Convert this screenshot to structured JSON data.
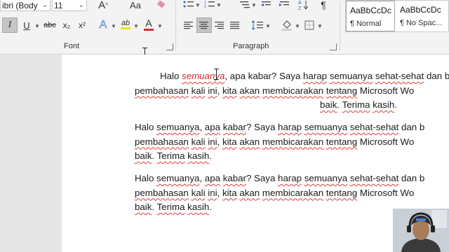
{
  "font": {
    "name_value": "ibri (Body",
    "size_value": "11",
    "group_label": "Font",
    "bold_italic_label": "I",
    "underline_label": "U",
    "strike_label": "abc",
    "subscript_label": "x₂",
    "superscript_label": "x²",
    "text_effects_label": "A",
    "change_case_label": "Aa",
    "highlight_label": "ab",
    "font_color_label": "A",
    "grow_label": "A",
    "highlight_color": "#f2e200",
    "font_color": "#d42a2a"
  },
  "paragraph": {
    "group_label": "Paragraph"
  },
  "styles": [
    {
      "preview": "AaBbCcDc",
      "name": "¶ Normal"
    },
    {
      "preview": "AaBbCcDc",
      "name": "¶ No Spac..."
    }
  ],
  "document": {
    "paragraphs": [
      {
        "align": "center",
        "lines": [
          [
            {
              "t": "Halo "
            },
            {
              "t": "semuanya",
              "s": "red"
            },
            {
              "t": ", apa kabar? Saya "
            },
            {
              "t": "harap",
              "s": "sq"
            },
            {
              "t": " "
            },
            {
              "t": "semuanya",
              "s": "sq"
            },
            {
              "t": " "
            },
            {
              "t": "sehat-sehat",
              "s": "sq"
            },
            {
              "t": " dan b"
            }
          ],
          [
            {
              "t": "pembahasan",
              "s": "sq"
            },
            {
              "t": " "
            },
            {
              "t": "kali",
              "s": "sq"
            },
            {
              "t": " "
            },
            {
              "t": "ini",
              "s": "sq"
            },
            {
              "t": ", "
            },
            {
              "t": "kita",
              "s": "sq"
            },
            {
              "t": " "
            },
            {
              "t": "akan",
              "s": "sq"
            },
            {
              "t": " "
            },
            {
              "t": "membicarakan",
              "s": "sq"
            },
            {
              "t": " "
            },
            {
              "t": "tentang",
              "s": "sq"
            },
            {
              "t": " Microsoft Wo"
            }
          ],
          [
            {
              "t": "baik",
              "s": "sq"
            },
            {
              "t": ". "
            },
            {
              "t": "Terima",
              "s": "sq"
            },
            {
              "t": " "
            },
            {
              "t": "kasih",
              "s": "sq"
            },
            {
              "t": "."
            }
          ]
        ]
      },
      {
        "align": "left",
        "lines": [
          [
            {
              "t": "Halo "
            },
            {
              "t": "semuanya",
              "s": "sq"
            },
            {
              "t": ", "
            },
            {
              "t": "apa",
              "s": "sq"
            },
            {
              "t": " "
            },
            {
              "t": "kabar",
              "s": "sq"
            },
            {
              "t": "? Saya "
            },
            {
              "t": "harap",
              "s": "sq"
            },
            {
              "t": " "
            },
            {
              "t": "semuanya",
              "s": "sq"
            },
            {
              "t": " "
            },
            {
              "t": "sehat-sehat",
              "s": "sq"
            },
            {
              "t": " dan b"
            }
          ],
          [
            {
              "t": "pembahasan",
              "s": "sq"
            },
            {
              "t": " "
            },
            {
              "t": "kali",
              "s": "sq"
            },
            {
              "t": " "
            },
            {
              "t": "ini",
              "s": "sq"
            },
            {
              "t": ", "
            },
            {
              "t": "kita",
              "s": "sq"
            },
            {
              "t": " "
            },
            {
              "t": "akan",
              "s": "sq"
            },
            {
              "t": " "
            },
            {
              "t": "membicarakan",
              "s": "sq"
            },
            {
              "t": " "
            },
            {
              "t": "tentang",
              "s": "sq"
            },
            {
              "t": " Microsoft Wo"
            }
          ],
          [
            {
              "t": "baik",
              "s": "sq"
            },
            {
              "t": ". "
            },
            {
              "t": "Terima",
              "s": "sq"
            },
            {
              "t": " "
            },
            {
              "t": "kasih",
              "s": "sq"
            },
            {
              "t": "."
            }
          ]
        ]
      },
      {
        "align": "left",
        "lines": [
          [
            {
              "t": "Halo "
            },
            {
              "t": "semuanya",
              "s": "sq"
            },
            {
              "t": ", "
            },
            {
              "t": "apa",
              "s": "sq"
            },
            {
              "t": " "
            },
            {
              "t": "kabar",
              "s": "sq"
            },
            {
              "t": "? Saya "
            },
            {
              "t": "harap",
              "s": "sq"
            },
            {
              "t": " "
            },
            {
              "t": "semuanya",
              "s": "sq"
            },
            {
              "t": " "
            },
            {
              "t": "sehat-sehat",
              "s": "sq"
            },
            {
              "t": " dan b"
            }
          ],
          [
            {
              "t": "pembahasan",
              "s": "sq"
            },
            {
              "t": " "
            },
            {
              "t": "kali",
              "s": "sq"
            },
            {
              "t": " "
            },
            {
              "t": "ini",
              "s": "sq"
            },
            {
              "t": ", "
            },
            {
              "t": "kita",
              "s": "sq"
            },
            {
              "t": " "
            },
            {
              "t": "akan",
              "s": "sq"
            },
            {
              "t": " "
            },
            {
              "t": "membicarakan",
              "s": "sq"
            },
            {
              "t": " "
            },
            {
              "t": "tentang",
              "s": "sq"
            },
            {
              "t": " Microsoft Wo"
            }
          ],
          [
            {
              "t": "baik",
              "s": "sq"
            },
            {
              "t": ". "
            },
            {
              "t": "Terima",
              "s": "sq"
            },
            {
              "t": " "
            },
            {
              "t": "kasih",
              "s": "sq"
            },
            {
              "t": "."
            }
          ]
        ]
      }
    ]
  },
  "icons": {
    "eraser": "clear-formatting-icon",
    "bullets": "bullets-icon",
    "numbering": "numbering-icon",
    "sort": "sort-icon",
    "pilcrow": "show-hide-icon",
    "align_left": "align-left-icon",
    "align_center": "align-center-icon",
    "align_right": "align-right-icon",
    "justify": "justify-icon",
    "line_spacing": "line-spacing-icon",
    "shading": "shading-icon",
    "borders": "borders-icon"
  }
}
